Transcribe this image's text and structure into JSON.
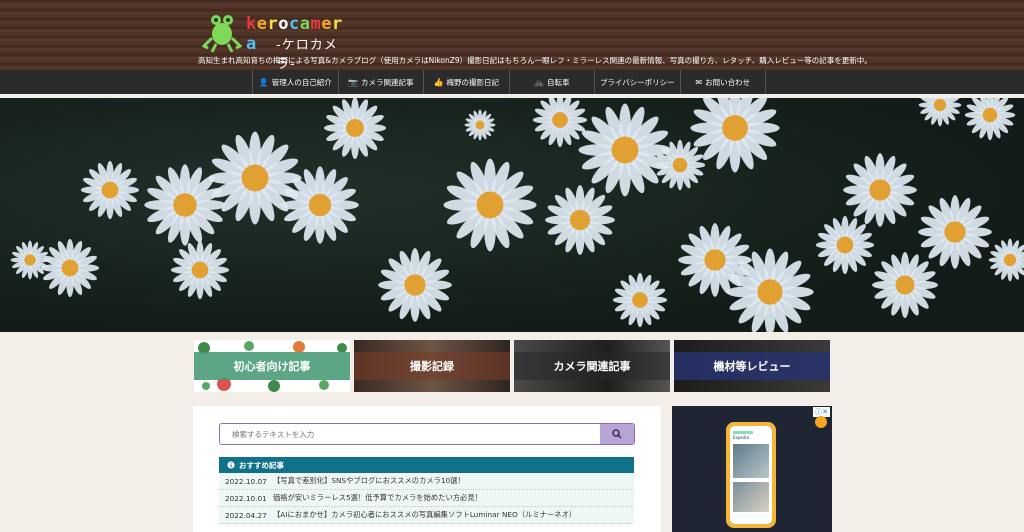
{
  "header": {
    "logo_text": "kerocamera",
    "logo_letter_colors": [
      "#e63b3b",
      "#f5a623",
      "#f5e04a",
      "#ffffff",
      "#4fc3f7",
      "#7bd45a",
      "#e63b3b",
      "#f5a623",
      "#f5e04a",
      "#4fc3f7"
    ],
    "logo_sub": "-ケロカメラ-",
    "tagline": "高知生まれ高知育ちの梅野による写真&カメラブログ（使用カメラはNikonZ9）撮影日記はもちろん一眼レフ・ミラーレス関連の最新情報、写真の撮り方、レタッチ、購入レビュー等の記事を更新中。"
  },
  "nav": {
    "items": [
      {
        "icon": "person-icon",
        "glyph": "👤",
        "label": "管理人の自己紹介"
      },
      {
        "icon": "camera-icon",
        "glyph": "📷",
        "label": "カメラ関連記事"
      },
      {
        "icon": "thumbs-up-icon",
        "glyph": "👍",
        "label": "梅野の撮影日記"
      },
      {
        "icon": "bicycle-icon",
        "glyph": "🚲",
        "label": "自転車"
      },
      {
        "icon": "",
        "glyph": "",
        "label": "プライバシーポリシー"
      },
      {
        "icon": "mail-icon",
        "glyph": "✉",
        "label": "お問い合わせ"
      }
    ]
  },
  "cards": [
    {
      "label": "初心者向け記事"
    },
    {
      "label": "撮影記録"
    },
    {
      "label": "カメラ関連記事"
    },
    {
      "label": "機材等レビュー"
    }
  ],
  "search": {
    "placeholder": "検索するテキストを入力"
  },
  "recommended": {
    "heading": "おすすめ記事",
    "items": [
      {
        "date": "2022.10.07",
        "title": "【写真で差別化】SNSやブログにおススメのカメラ10選！"
      },
      {
        "date": "2022.10.01",
        "title": "価格が安いミラーレス5選！低予算でカメラを始めたい方必見！"
      },
      {
        "date": "2022.04.27",
        "title": "【AIにおまかせ】カメラ初心者におススメの写真編集ソフトLuminar NEO（ルミナーネオ）"
      }
    ]
  },
  "ad": {
    "close_label": "ⓘ✕",
    "app_title": "Expedia"
  }
}
